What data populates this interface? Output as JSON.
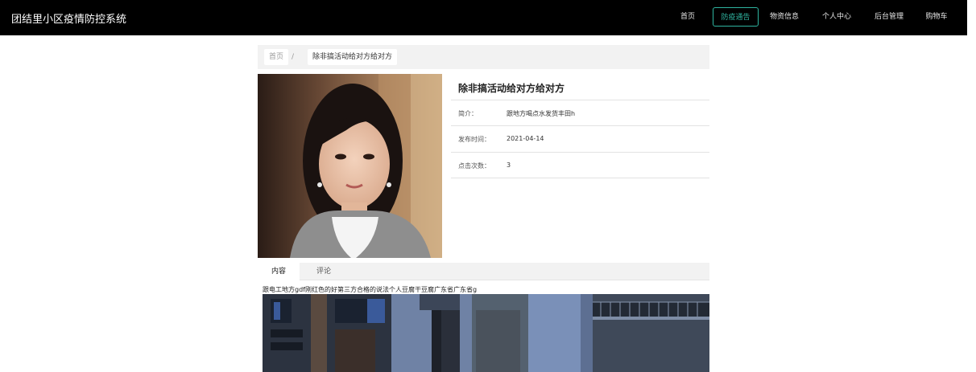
{
  "app": {
    "title": "团结里小区疫情防控系统"
  },
  "nav": {
    "items": [
      {
        "label": "首页"
      },
      {
        "label": "防疫通告"
      },
      {
        "label": "物资信息"
      },
      {
        "label": "个人中心"
      },
      {
        "label": "后台管理"
      },
      {
        "label": "购物车"
      }
    ],
    "active_index": 1,
    "accent_color": "#2fb5a0"
  },
  "breadcrumb": {
    "home": "首页",
    "separator": "/",
    "current": "除非搞活动给对方给对方"
  },
  "detail": {
    "title": "除非搞活动给对方给对方",
    "fields": [
      {
        "label": "简介：",
        "value": "跟地方喝点水发货丰田h"
      },
      {
        "label": "发布时间：",
        "value": "2021-04-14"
      },
      {
        "label": "点击次数：",
        "value": "3"
      }
    ]
  },
  "tabs": [
    {
      "label": "内容"
    },
    {
      "label": "评论"
    }
  ],
  "content": {
    "text": "跟电工地方gdf刚红色的好第三方合格的说法个人豆腐干豆腐广东省广东省g"
  }
}
